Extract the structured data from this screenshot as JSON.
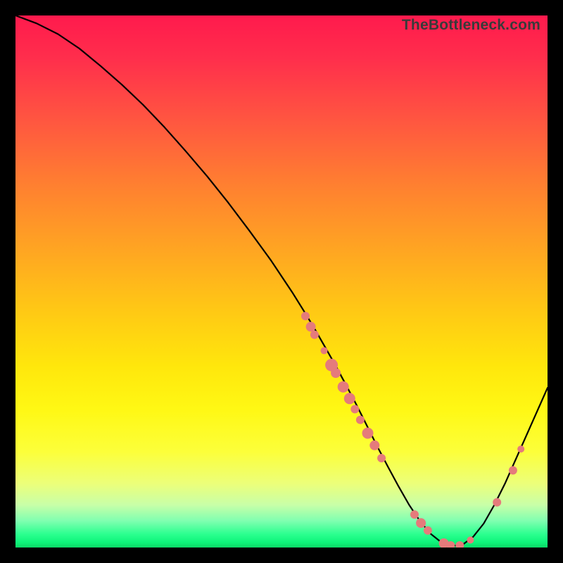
{
  "watermark": "TheBottleneck.com",
  "chart_data": {
    "type": "line",
    "title": "",
    "xlabel": "",
    "ylabel": "",
    "xlim": [
      0,
      100
    ],
    "ylim": [
      0,
      100
    ],
    "grid": false,
    "legend": false,
    "series": [
      {
        "name": "curve",
        "x": [
          0,
          4,
          8,
          12,
          16,
          20,
          24,
          28,
          32,
          36,
          40,
          44,
          48,
          52,
          54,
          56,
          58,
          60,
          62,
          64,
          66,
          68,
          70,
          72,
          74,
          76,
          78,
          80,
          82,
          84,
          86,
          88,
          90,
          92,
          94,
          96,
          98,
          100
        ],
        "y": [
          100,
          98.5,
          96.5,
          93.8,
          90.5,
          87,
          83.2,
          79,
          74.5,
          69.8,
          64.8,
          59.5,
          54,
          48,
          44.8,
          41.5,
          38,
          34.5,
          30.8,
          27,
          23,
          19,
          15.2,
          11.5,
          8,
          5,
          2.6,
          1,
          0.3,
          0.5,
          2,
          4.5,
          8,
          12,
          16.5,
          21,
          25.5,
          30
        ]
      }
    ],
    "scatter_points": {
      "name": "markers",
      "color": "#e57b7b",
      "points": [
        {
          "x": 54.5,
          "y": 43.5,
          "r": 6
        },
        {
          "x": 55.5,
          "y": 41.5,
          "r": 7
        },
        {
          "x": 56.2,
          "y": 40.0,
          "r": 6
        },
        {
          "x": 58.0,
          "y": 37.0,
          "r": 5
        },
        {
          "x": 59.4,
          "y": 34.3,
          "r": 9
        },
        {
          "x": 60.2,
          "y": 32.8,
          "r": 7
        },
        {
          "x": 61.6,
          "y": 30.2,
          "r": 8
        },
        {
          "x": 62.8,
          "y": 28.0,
          "r": 8
        },
        {
          "x": 63.8,
          "y": 26.0,
          "r": 6
        },
        {
          "x": 64.8,
          "y": 24.0,
          "r": 6
        },
        {
          "x": 66.2,
          "y": 21.5,
          "r": 8
        },
        {
          "x": 67.5,
          "y": 19.2,
          "r": 7
        },
        {
          "x": 68.8,
          "y": 16.8,
          "r": 6
        },
        {
          "x": 75.0,
          "y": 6.2,
          "r": 6
        },
        {
          "x": 76.2,
          "y": 4.6,
          "r": 7
        },
        {
          "x": 77.5,
          "y": 3.2,
          "r": 6
        },
        {
          "x": 80.5,
          "y": 0.8,
          "r": 7
        },
        {
          "x": 81.8,
          "y": 0.4,
          "r": 6
        },
        {
          "x": 83.5,
          "y": 0.4,
          "r": 6
        },
        {
          "x": 85.5,
          "y": 1.4,
          "r": 5
        },
        {
          "x": 90.5,
          "y": 8.5,
          "r": 6
        },
        {
          "x": 93.5,
          "y": 14.5,
          "r": 6
        },
        {
          "x": 95.0,
          "y": 18.5,
          "r": 5
        }
      ]
    }
  }
}
